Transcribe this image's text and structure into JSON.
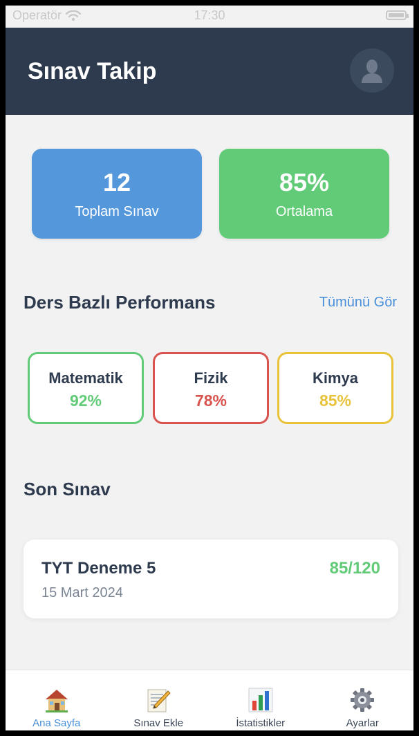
{
  "status_bar": {
    "carrier": "Operatör",
    "time": "17:30"
  },
  "header": {
    "title": "Sınav Takip"
  },
  "stats": [
    {
      "value": "12",
      "label": "Toplam Sınav",
      "color": "#5497db"
    },
    {
      "value": "85%",
      "label": "Ortalama",
      "color": "#62cb78"
    }
  ],
  "performance": {
    "title": "Ders Bazlı Performans",
    "see_all": "Tümünü Gör",
    "subjects": [
      {
        "name": "Matematik",
        "percent": "92%",
        "color": "#62cb78"
      },
      {
        "name": "Fizik",
        "percent": "78%",
        "color": "#d9534f"
      },
      {
        "name": "Kimya",
        "percent": "85%",
        "color": "#e8c33a"
      }
    ]
  },
  "last_exam": {
    "title": "Son Sınav",
    "name": "TYT Deneme 5",
    "date": "15 Mart 2024",
    "score": "85/120"
  },
  "tabs": [
    {
      "label": "Ana Sayfa",
      "icon": "house-icon",
      "active": true
    },
    {
      "label": "Sınav Ekle",
      "icon": "pencil-paper-icon",
      "active": false
    },
    {
      "label": "İstatistikler",
      "icon": "bar-chart-icon",
      "active": false
    },
    {
      "label": "Ayarlar",
      "icon": "gear-icon",
      "active": false
    }
  ],
  "colors": {
    "accent": "#4a90d9",
    "header_bg": "#2e3b4e"
  }
}
